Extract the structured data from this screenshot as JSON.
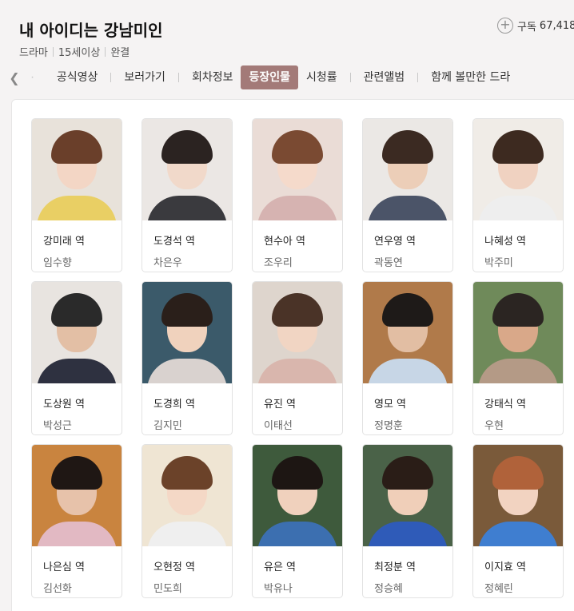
{
  "header": {
    "title": "내 아이디는 강남미인",
    "subscribe_label": "구독",
    "subscribe_count": "67,418",
    "meta": [
      "드라마",
      "15세이상",
      "완결"
    ]
  },
  "tabs": {
    "partial": "ㆍ",
    "items": [
      "공식영상",
      "보러가기",
      "회차정보",
      "등장인물",
      "시청률",
      "관련앨범",
      "함께 볼만한 드라"
    ],
    "active": "등장인물"
  },
  "cast": [
    {
      "role": "강미래 역",
      "actor": "임수향",
      "bg": "#e8e2da",
      "hair": "#6a3f2a",
      "skin": "#f3d6c5",
      "body": "#e9cf64"
    },
    {
      "role": "도경석 역",
      "actor": "차은우",
      "bg": "#ebe7e4",
      "hair": "#2b2321",
      "skin": "#f1d9ca",
      "body": "#3a3a3e"
    },
    {
      "role": "현수아 역",
      "actor": "조우리",
      "bg": "#eadcd6",
      "hair": "#7a4a32",
      "skin": "#f5dacb",
      "body": "#d6b3b1"
    },
    {
      "role": "연우영 역",
      "actor": "곽동연",
      "bg": "#ebe8e5",
      "hair": "#3b2a22",
      "skin": "#ecceb8",
      "body": "#4b5468"
    },
    {
      "role": "나혜성 역",
      "actor": "박주미",
      "bg": "#f0ece7",
      "hair": "#3d2a20",
      "skin": "#f0d2c1",
      "body": "#eeeeee"
    },
    {
      "role": "도상원 역",
      "actor": "박성근",
      "bg": "#e8e4e0",
      "hair": "#2a2a2a",
      "skin": "#e3bfa5",
      "body": "#2e3140"
    },
    {
      "role": "도경희 역",
      "actor": "김지민",
      "bg": "#3b5a6a",
      "hair": "#2a1f1a",
      "skin": "#f0d2bd",
      "body": "#d9d2cf"
    },
    {
      "role": "유진 역",
      "actor": "이태선",
      "bg": "#ded5cd",
      "hair": "#4a3327",
      "skin": "#f1d5c3",
      "body": "#d9b6ad"
    },
    {
      "role": "영모 역",
      "actor": "정명훈",
      "bg": "#b07a4a",
      "hair": "#1e1a18",
      "skin": "#e2bea3",
      "body": "#c7d6e6"
    },
    {
      "role": "강태식 역",
      "actor": "우현",
      "bg": "#6f8a5a",
      "hair": "#2b2522",
      "skin": "#d9a889",
      "body": "#b49a86"
    },
    {
      "role": "나은심 역",
      "actor": "김선화",
      "bg": "#c9843f",
      "hair": "#1f1714",
      "skin": "#e7c2aa",
      "body": "#e2b9c3"
    },
    {
      "role": "오현정 역",
      "actor": "민도희",
      "bg": "#efe5d3",
      "hair": "#6b4229",
      "skin": "#f4d8c6",
      "body": "#efefef"
    },
    {
      "role": "유은 역",
      "actor": "박유나",
      "bg": "#3e5a3c",
      "hair": "#1d1613",
      "skin": "#f0d1bd",
      "body": "#3c6fb0"
    },
    {
      "role": "최정분 역",
      "actor": "정승혜",
      "bg": "#4a6248",
      "hair": "#2a1d17",
      "skin": "#f0cfb9",
      "body": "#2f5bb8"
    },
    {
      "role": "이지효 역",
      "actor": "정혜린",
      "bg": "#7a5a3a",
      "hair": "#b0623a",
      "skin": "#f2d3c1",
      "body": "#3f7ed0"
    }
  ]
}
